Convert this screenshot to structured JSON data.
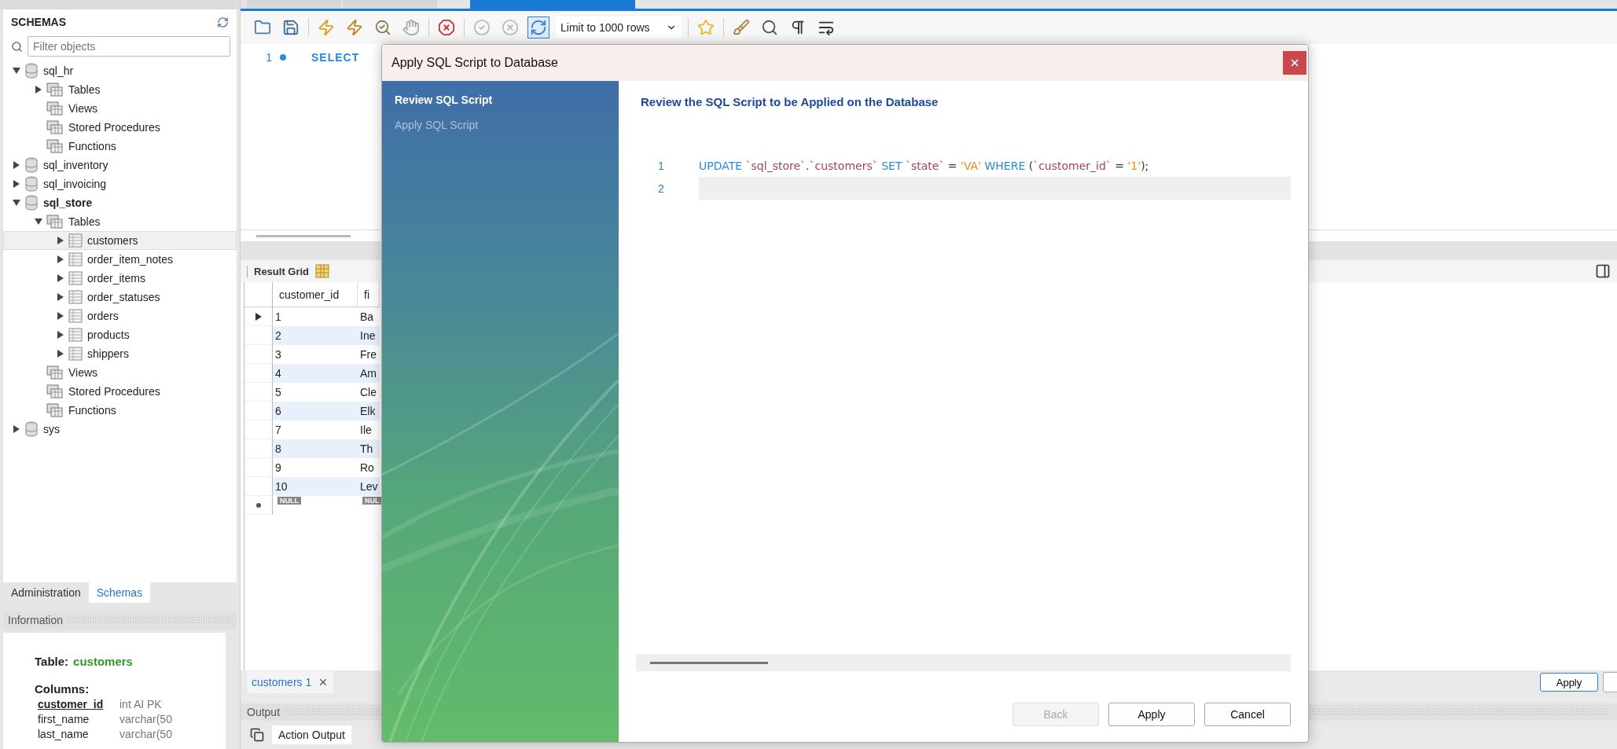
{
  "editor_tabs": [
    {
      "selected": false
    },
    {
      "selected": false
    },
    {
      "selected": true
    }
  ],
  "navigator": {
    "title": "SCHEMAS",
    "filter": {
      "placeholder": "Filter objects"
    },
    "tree": [
      {
        "label": "sql_hr",
        "kind": "schema",
        "expanded": true,
        "default": false,
        "selected": false,
        "children": [
          {
            "label": "Tables",
            "kind": "folder",
            "expanded": false,
            "selected": false
          },
          {
            "label": "Views",
            "kind": "folder",
            "selected": false
          },
          {
            "label": "Stored Procedures",
            "kind": "folder",
            "selected": false
          },
          {
            "label": "Functions",
            "kind": "folder",
            "selected": false
          }
        ]
      },
      {
        "label": "sql_inventory",
        "kind": "schema",
        "expanded": false,
        "default": false,
        "selected": false
      },
      {
        "label": "sql_invoicing",
        "kind": "schema",
        "expanded": false,
        "default": false,
        "selected": false
      },
      {
        "label": "sql_store",
        "kind": "schema",
        "expanded": true,
        "default": true,
        "selected": false,
        "children": [
          {
            "label": "Tables",
            "kind": "folder",
            "expanded": true,
            "selected": false,
            "children": [
              {
                "label": "customers",
                "kind": "table",
                "expanded": false,
                "selected": true
              },
              {
                "label": "order_item_notes",
                "kind": "table",
                "expanded": false,
                "selected": false
              },
              {
                "label": "order_items",
                "kind": "table",
                "expanded": false,
                "selected": false
              },
              {
                "label": "order_statuses",
                "kind": "table",
                "expanded": false,
                "selected": false
              },
              {
                "label": "orders",
                "kind": "table",
                "expanded": false,
                "selected": false
              },
              {
                "label": "products",
                "kind": "table",
                "expanded": false,
                "selected": false
              },
              {
                "label": "shippers",
                "kind": "table",
                "expanded": false,
                "selected": false
              }
            ]
          },
          {
            "label": "Views",
            "kind": "folder",
            "selected": false
          },
          {
            "label": "Stored Procedures",
            "kind": "folder",
            "selected": false
          },
          {
            "label": "Functions",
            "kind": "folder",
            "selected": false
          }
        ]
      },
      {
        "label": "sys",
        "kind": "schema",
        "expanded": false,
        "default": false,
        "selected": false
      }
    ],
    "tabs": [
      {
        "label": "Administration",
        "selected": false
      },
      {
        "label": "Schemas",
        "selected": true
      }
    ]
  },
  "information": {
    "title": "Information",
    "table_label": "Table:",
    "table_name": "customers",
    "columns_label": "Columns:",
    "columns": [
      {
        "name": "customer_id",
        "type": "int AI PK",
        "primary": true
      },
      {
        "name": "first_name",
        "type": "varchar(50",
        "primary": false
      },
      {
        "name": "last_name",
        "type": "varchar(50",
        "primary": false
      }
    ]
  },
  "toolbar": {
    "items": [
      {
        "kind": "open"
      },
      {
        "kind": "save"
      },
      {
        "kind": "separator"
      },
      {
        "kind": "execute"
      },
      {
        "kind": "execute_current"
      },
      {
        "kind": "explain"
      },
      {
        "kind": "stop"
      },
      {
        "kind": "separator"
      },
      {
        "kind": "error_stop"
      },
      {
        "kind": "separator"
      },
      {
        "kind": "commit"
      },
      {
        "kind": "rollback"
      },
      {
        "kind": "autocommit",
        "on": true
      },
      {
        "kind": "limit",
        "label": "Limit to 1000 rows"
      },
      {
        "kind": "separator"
      },
      {
        "kind": "bookmark"
      },
      {
        "kind": "separator"
      },
      {
        "kind": "beautify"
      },
      {
        "kind": "find"
      },
      {
        "kind": "invisible"
      },
      {
        "kind": "wrap"
      }
    ]
  },
  "editor": {
    "lines": [
      {
        "number": "1",
        "text": "SELECT"
      }
    ]
  },
  "result": {
    "title": "Result Grid",
    "columns": [
      "customer_id",
      "fi"
    ],
    "rows": [
      {
        "cells": [
          "1",
          "Ba"
        ],
        "current": true
      },
      {
        "cells": [
          "2",
          "Ine"
        ],
        "current": false
      },
      {
        "cells": [
          "3",
          "Fre"
        ],
        "current": false
      },
      {
        "cells": [
          "4",
          "Am"
        ],
        "current": false
      },
      {
        "cells": [
          "5",
          "Cle"
        ],
        "current": false
      },
      {
        "cells": [
          "6",
          "Elk"
        ],
        "current": false
      },
      {
        "cells": [
          "7",
          "Ile"
        ],
        "current": false
      },
      {
        "cells": [
          "8",
          "Th"
        ],
        "current": false
      },
      {
        "cells": [
          "9",
          "Ro"
        ],
        "current": false
      },
      {
        "cells": [
          "10",
          "Lev"
        ],
        "current": false
      }
    ],
    "new_row": [
      "NULL",
      "NUL"
    ]
  },
  "bottom_tabs": [
    {
      "label": "customers 1",
      "selected": true
    }
  ],
  "apply_button": "Apply",
  "output": {
    "title": "Output",
    "mode": "Action Output"
  },
  "dialog": {
    "title": "Apply SQL Script to Database",
    "steps": [
      {
        "label": "Review SQL Script",
        "selected": true
      },
      {
        "label": "Apply SQL Script",
        "selected": false
      }
    ],
    "heading": "Review the SQL Script to be Applied on the Database",
    "lines": [
      {
        "number": "1",
        "current": false,
        "tokens": [
          {
            "text": "UPDATE ",
            "kind": "keyword"
          },
          {
            "text": "`sql_store`",
            "kind": "ident"
          },
          {
            "text": ".",
            "kind": "plain"
          },
          {
            "text": "`customers`",
            "kind": "ident"
          },
          {
            "text": " SET ",
            "kind": "keyword"
          },
          {
            "text": "`state`",
            "kind": "ident"
          },
          {
            "text": " = ",
            "kind": "plain"
          },
          {
            "text": "'VA'",
            "kind": "string"
          },
          {
            "text": " WHERE ",
            "kind": "keyword"
          },
          {
            "text": "(",
            "kind": "plain"
          },
          {
            "text": "`customer_id`",
            "kind": "ident"
          },
          {
            "text": " = ",
            "kind": "plain"
          },
          {
            "text": "'1'",
            "kind": "string"
          },
          {
            "text": ");",
            "kind": "plain"
          }
        ]
      },
      {
        "number": "2",
        "current": true
      }
    ],
    "buttons": [
      {
        "label": "Back",
        "disabled": true
      },
      {
        "label": "Apply",
        "disabled": false
      },
      {
        "label": "Cancel",
        "disabled": false
      }
    ]
  }
}
